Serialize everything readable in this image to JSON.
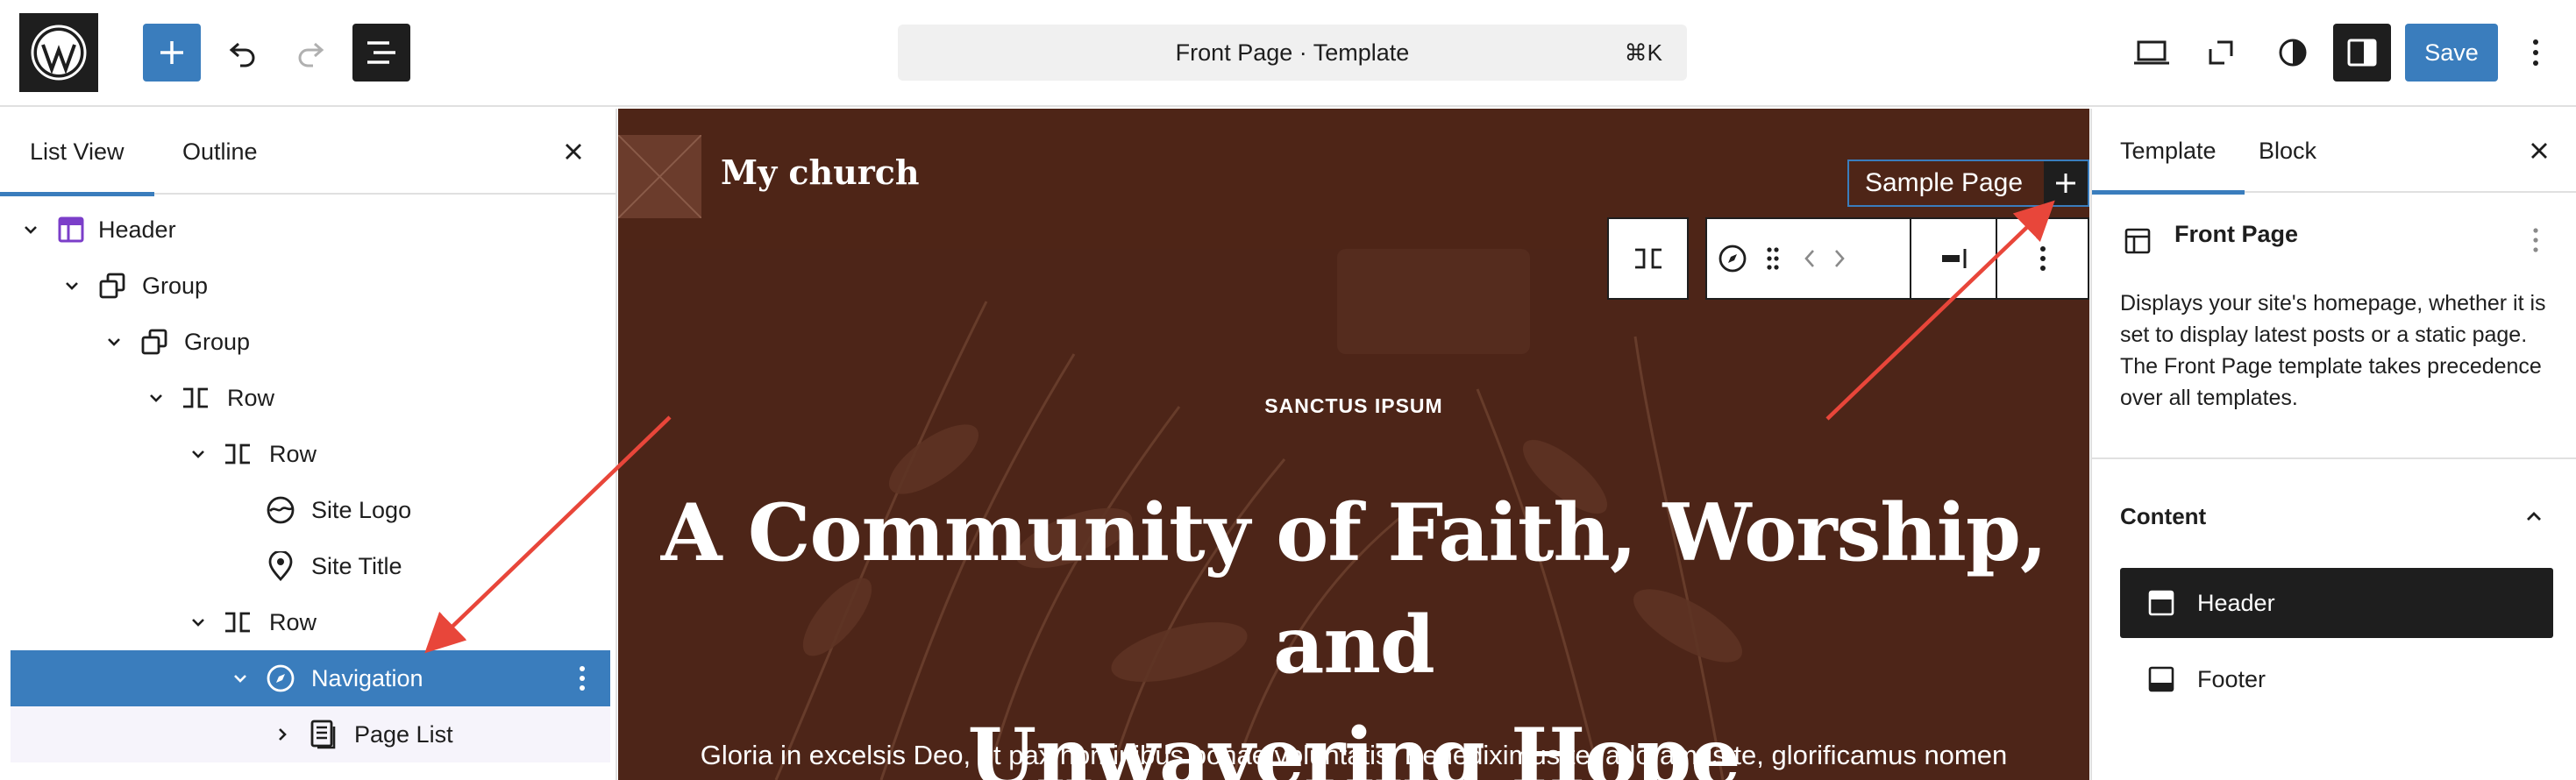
{
  "topbar": {
    "command_title": "Front Page · Template",
    "command_shortcut": "⌘K",
    "save_label": "Save"
  },
  "left_panel": {
    "tabs": [
      {
        "label": "List View",
        "active": true
      },
      {
        "label": "Outline",
        "active": false
      }
    ],
    "tree": [
      {
        "label": "Header",
        "icon": "template-part-icon",
        "depth": 0,
        "expanded": true
      },
      {
        "label": "Group",
        "icon": "group-icon",
        "depth": 1,
        "expanded": true
      },
      {
        "label": "Group",
        "icon": "group-icon",
        "depth": 2,
        "expanded": true
      },
      {
        "label": "Row",
        "icon": "row-icon",
        "depth": 3,
        "expanded": true
      },
      {
        "label": "Row",
        "icon": "row-icon",
        "depth": 4,
        "expanded": true
      },
      {
        "label": "Site Logo",
        "icon": "site-logo-icon",
        "depth": 5
      },
      {
        "label": "Site Title",
        "icon": "map-marker-icon",
        "depth": 5
      },
      {
        "label": "Row",
        "icon": "row-icon",
        "depth": 4,
        "expanded": true
      },
      {
        "label": "Navigation",
        "icon": "compass-icon",
        "depth": 5,
        "expanded": true,
        "selected": true
      },
      {
        "label": "Page List",
        "icon": "page-list-icon",
        "depth": 6,
        "expanded": false
      }
    ]
  },
  "canvas": {
    "site_title": "My church",
    "nav_link": "Sample Page",
    "eyebrow": "SANCTUS IPSUM",
    "heading_line1": "A Community of Faith, Worship, and",
    "heading_line2": "Unwavering Hope",
    "body_text": "Gloria in excelsis Deo, et pax hominibus bonae voluntatis. Benediximus te, adoramus te, glorificamus nomen",
    "colors": {
      "background": "#4d2518",
      "header": "#4e2517",
      "selection": "#3a7dbd"
    }
  },
  "right_panel": {
    "tabs": [
      {
        "label": "Template",
        "active": true
      },
      {
        "label": "Block",
        "active": false
      }
    ],
    "template_title": "Front Page",
    "template_description": "Displays your site's homepage, whether it is set to display latest posts or a static page. The Front Page template takes precedence over all templates.",
    "content_title": "Content",
    "parts": [
      {
        "label": "Header",
        "icon": "header-part-icon",
        "active": true
      },
      {
        "label": "Footer",
        "icon": "footer-part-icon",
        "active": false
      }
    ]
  }
}
